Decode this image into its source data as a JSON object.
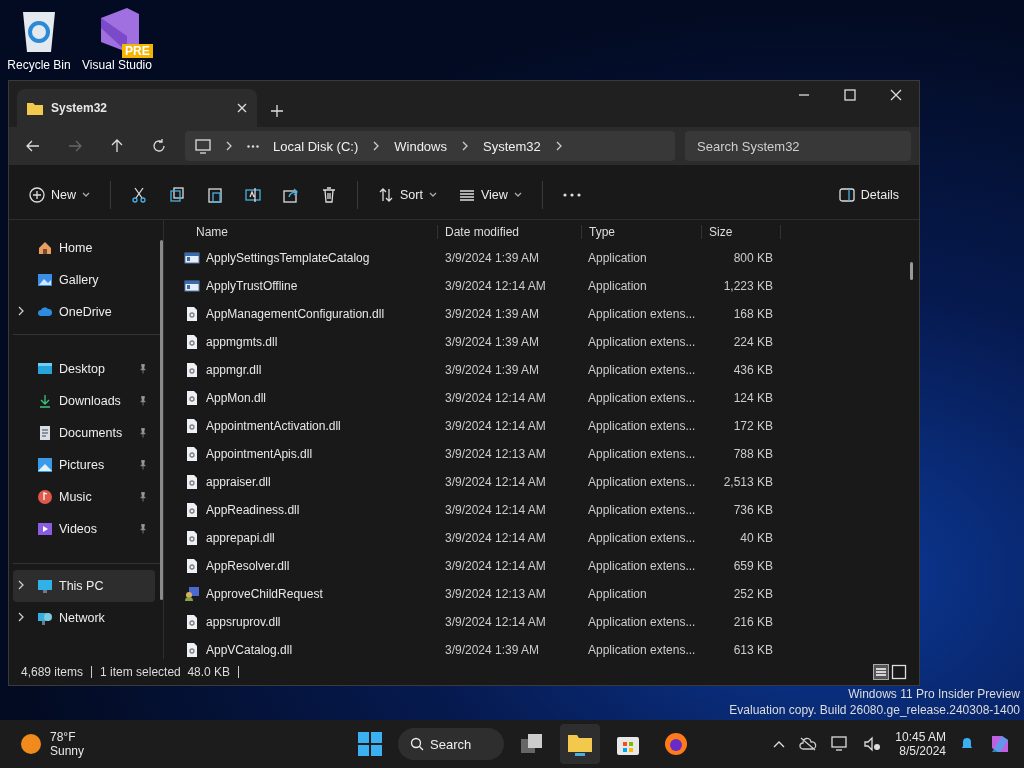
{
  "desktop_icons": [
    {
      "kind": "recycle",
      "label": "Recycle Bin"
    },
    {
      "kind": "vs",
      "label": "Visual Studio",
      "badge": "PRE"
    }
  ],
  "window": {
    "tabs": [
      {
        "title": "System32",
        "selected": true
      }
    ],
    "breadcrumb": [
      "Local Disk (C:)",
      "Windows",
      "System32"
    ],
    "search": {
      "placeholder": "Search System32"
    },
    "toolbar": {
      "new": "New",
      "sort": "Sort",
      "view": "View",
      "details": "Details"
    },
    "sidebar": {
      "groups": [
        [
          {
            "kind": "home",
            "label": "Home",
            "expandable": false,
            "pinned": false,
            "selected": false
          },
          {
            "kind": "gallery",
            "label": "Gallery",
            "expandable": false,
            "pinned": false,
            "selected": false
          },
          {
            "kind": "cloud",
            "label": "OneDrive",
            "expandable": true,
            "pinned": false,
            "selected": false
          }
        ],
        [
          {
            "kind": "desktop",
            "label": "Desktop",
            "expandable": false,
            "pinned": true,
            "selected": false
          },
          {
            "kind": "download",
            "label": "Downloads",
            "expandable": false,
            "pinned": true,
            "selected": false
          },
          {
            "kind": "documents",
            "label": "Documents",
            "expandable": false,
            "pinned": true,
            "selected": false
          },
          {
            "kind": "pictures",
            "label": "Pictures",
            "expandable": false,
            "pinned": true,
            "selected": false
          },
          {
            "kind": "music",
            "label": "Music",
            "expandable": false,
            "pinned": true,
            "selected": false
          },
          {
            "kind": "videos",
            "label": "Videos",
            "expandable": false,
            "pinned": true,
            "selected": false
          }
        ],
        [
          {
            "kind": "pc",
            "label": "This PC",
            "expandable": true,
            "pinned": false,
            "selected": true
          },
          {
            "kind": "network",
            "label": "Network",
            "expandable": true,
            "pinned": false,
            "selected": false
          }
        ]
      ]
    },
    "table": {
      "columns": [
        "Name",
        "Date modified",
        "Type",
        "Size"
      ],
      "rows": [
        {
          "kind": "app",
          "name": "ApplySettingsTemplateCatalog",
          "date": "3/9/2024 1:39 AM",
          "type": "Application",
          "size": "800 KB"
        },
        {
          "kind": "app",
          "name": "ApplyTrustOffline",
          "date": "3/9/2024 12:14 AM",
          "type": "Application",
          "size": "1,223 KB"
        },
        {
          "kind": "dll",
          "name": "AppManagementConfiguration.dll",
          "date": "3/9/2024 1:39 AM",
          "type": "Application extens...",
          "size": "168 KB"
        },
        {
          "kind": "dll",
          "name": "appmgmts.dll",
          "date": "3/9/2024 1:39 AM",
          "type": "Application extens...",
          "size": "224 KB"
        },
        {
          "kind": "dll",
          "name": "appmgr.dll",
          "date": "3/9/2024 1:39 AM",
          "type": "Application extens...",
          "size": "436 KB"
        },
        {
          "kind": "dll",
          "name": "AppMon.dll",
          "date": "3/9/2024 12:14 AM",
          "type": "Application extens...",
          "size": "124 KB"
        },
        {
          "kind": "dll",
          "name": "AppointmentActivation.dll",
          "date": "3/9/2024 12:14 AM",
          "type": "Application extens...",
          "size": "172 KB"
        },
        {
          "kind": "dll",
          "name": "AppointmentApis.dll",
          "date": "3/9/2024 12:13 AM",
          "type": "Application extens...",
          "size": "788 KB"
        },
        {
          "kind": "dll",
          "name": "appraiser.dll",
          "date": "3/9/2024 12:14 AM",
          "type": "Application extens...",
          "size": "2,513 KB"
        },
        {
          "kind": "dll",
          "name": "AppReadiness.dll",
          "date": "3/9/2024 12:14 AM",
          "type": "Application extens...",
          "size": "736 KB"
        },
        {
          "kind": "dll",
          "name": "apprepapi.dll",
          "date": "3/9/2024 12:14 AM",
          "type": "Application extens...",
          "size": "40 KB"
        },
        {
          "kind": "dll",
          "name": "AppResolver.dll",
          "date": "3/9/2024 12:14 AM",
          "type": "Application extens...",
          "size": "659 KB"
        },
        {
          "kind": "user-app",
          "name": "ApproveChildRequest",
          "date": "3/9/2024 12:13 AM",
          "type": "Application",
          "size": "252 KB"
        },
        {
          "kind": "dll",
          "name": "appsruprov.dll",
          "date": "3/9/2024 12:14 AM",
          "type": "Application extens...",
          "size": "216 KB"
        },
        {
          "kind": "dll",
          "name": "AppVCatalog.dll",
          "date": "3/9/2024 1:39 AM",
          "type": "Application extens...",
          "size": "613 KB"
        }
      ]
    },
    "status_bar": {
      "items": "4,689 items",
      "selection": "1 item selected  48.0 KB"
    }
  },
  "watermark": [
    "Windows 11 Pro Insider Preview",
    "Evaluation copy. Build 26080.ge_release.240308-1400"
  ],
  "taskbar": {
    "weather": {
      "temp": "78°F",
      "condition": "Sunny"
    },
    "search": "Search",
    "time": "10:45 AM",
    "date": "8/5/2024"
  }
}
